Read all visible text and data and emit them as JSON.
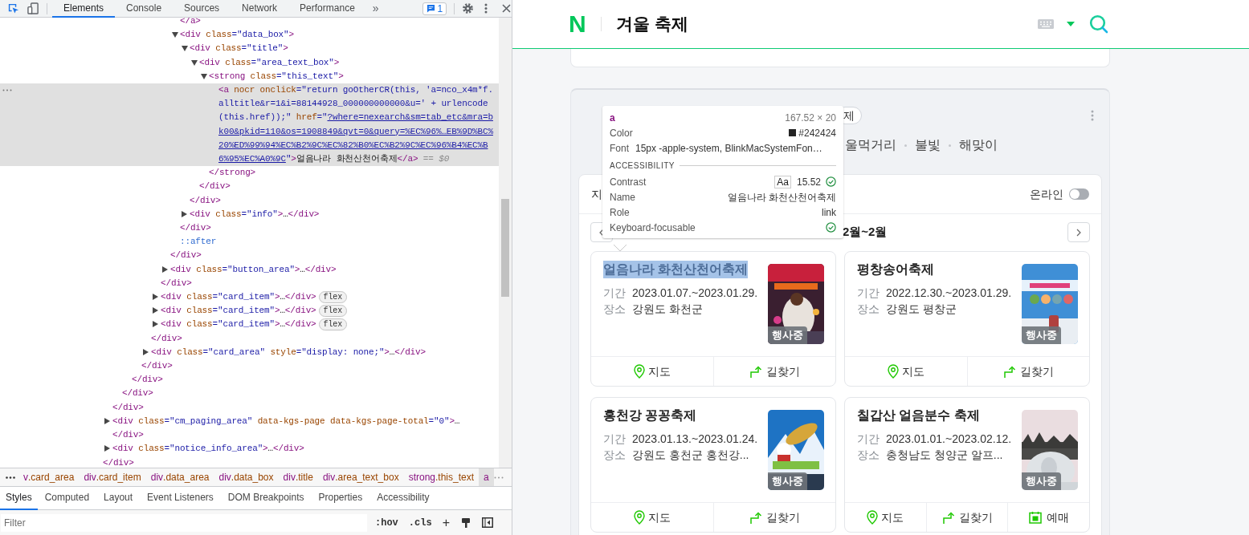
{
  "devtools": {
    "tabs": [
      {
        "label": "Elements",
        "selected": true
      },
      {
        "label": "Console",
        "selected": false
      },
      {
        "label": "Sources",
        "selected": false
      },
      {
        "label": "Network",
        "selected": false
      },
      {
        "label": "Performance",
        "selected": false
      }
    ],
    "more_tabs": "»",
    "issues_count": "1",
    "dom_tree": [
      {
        "children": [
          {
            "children": [
              {
                "children": [
                  {
                    "children": [
                      {
                        "children": [
                          {
                            "children": [
                              {
                                "children": [
                                  {
                                    "children": [
                                      {
                                        "close": [
                                          {
                                            "kind": "tag",
                                            "text": "</a>"
                                          }
                                        ]
                                      },
                                      {
                                        "selected": false,
                                        "expanded": true,
                                        "open": [
                                          {
                                            "kind": "tag",
                                            "text": "<div"
                                          },
                                          {
                                            "kind": "attr",
                                            "text": " class"
                                          },
                                          {
                                            "kind": "eq",
                                            "text": "="
                                          },
                                          {
                                            "kind": "val",
                                            "text": "\"data_box\""
                                          },
                                          {
                                            "kind": "tag",
                                            "text": ">"
                                          }
                                        ],
                                        "children": [
                                          {
                                            "selected": false,
                                            "expanded": true,
                                            "open": [
                                              {
                                                "kind": "tag",
                                                "text": "<div"
                                              },
                                              {
                                                "kind": "attr",
                                                "text": " class"
                                              },
                                              {
                                                "kind": "eq",
                                                "text": "="
                                              },
                                              {
                                                "kind": "val",
                                                "text": "\"title\""
                                              },
                                              {
                                                "kind": "tag",
                                                "text": ">"
                                              }
                                            ],
                                            "children": [
                                              {
                                                "selected": false,
                                                "expanded": true,
                                                "open": [
                                                  {
                                                    "kind": "tag",
                                                    "text": "<div"
                                                  },
                                                  {
                                                    "kind": "attr",
                                                    "text": " class"
                                                  },
                                                  {
                                                    "kind": "eq",
                                                    "text": "="
                                                  },
                                                  {
                                                    "kind": "val",
                                                    "text": "\"area_text_box\""
                                                  },
                                                  {
                                                    "kind": "tag",
                                                    "text": ">"
                                                  }
                                                ],
                                                "children": [
                                                  {
                                                    "selected": false,
                                                    "expanded": true,
                                                    "open": [
                                                      {
                                                        "kind": "tag",
                                                        "text": "<strong"
                                                      },
                                                      {
                                                        "kind": "attr",
                                                        "text": " class"
                                                      },
                                                      {
                                                        "kind": "eq",
                                                        "text": "="
                                                      },
                                                      {
                                                        "kind": "val",
                                                        "text": "\"this_text\""
                                                      },
                                                      {
                                                        "kind": "tag",
                                                        "text": ">"
                                                      }
                                                    ],
                                                    "children": [
                                                      {
                                                        "selected": true,
                                                        "open": [
                                                          {
                                                            "kind": "tag",
                                                            "text": "<a"
                                                          },
                                                          {
                                                            "kind": "attr",
                                                            "text": " nocr"
                                                          },
                                                          {
                                                            "kind": "attr",
                                                            "text": " onclick"
                                                          },
                                                          {
                                                            "kind": "eq",
                                                            "text": "=\""
                                                          },
                                                          {
                                                            "kind": "val",
                                                            "text": "return goOtherCR(this, 'a=nco_x4m*f.alltitle&r=1&i=88144928_000000000000&u=' + urlencode(this.href));"
                                                          },
                                                          {
                                                            "kind": "eq",
                                                            "text": "\""
                                                          },
                                                          {
                                                            "kind": "attr",
                                                            "text": " href"
                                                          },
                                                          {
                                                            "kind": "eq",
                                                            "text": "=\""
                                                          },
                                                          {
                                                            "kind": "link",
                                                            "text": "?where=nexearch&sm=tab_etc&mra=bk00&pkid=110&os=1908849&qvt=0&query=%EC%96%…EB%9D%BC%20%ED%99%94%EC%B2%9C%EC%82%B0%EC%B2%9C%EC%96%B4%EC%B6%95%EC%A0%9C"
                                                          },
                                                          {
                                                            "kind": "eq",
                                                            "text": "\""
                                                          },
                                                          {
                                                            "kind": "tag",
                                                            "text": ">"
                                                          },
                                                          {
                                                            "kind": "text",
                                                            "text": "얼음나라 화천산천어축제"
                                                          },
                                                          {
                                                            "kind": "tag",
                                                            "text": "</a>"
                                                          },
                                                          {
                                                            "kind": "note",
                                                            "text": " == $0"
                                                          }
                                                        ]
                                                      }
                                                    ],
                                                    "close": [
                                                      {
                                                        "kind": "tag",
                                                        "text": "</strong>"
                                                      }
                                                    ]
                                                  }
                                                ],
                                                "close": [
                                                  {
                                                    "kind": "tag",
                                                    "text": "</div>"
                                                  }
                                                ]
                                              }
                                            ],
                                            "close": [
                                              {
                                                "kind": "tag",
                                                "text": "</div>"
                                              }
                                            ]
                                          },
                                          {
                                            "selected": false,
                                            "expanded": false,
                                            "open": [
                                              {
                                                "kind": "tag",
                                                "text": "<div"
                                              },
                                              {
                                                "kind": "attr",
                                                "text": " class"
                                              },
                                              {
                                                "kind": "eq",
                                                "text": "="
                                              },
                                              {
                                                "kind": "val",
                                                "text": "\"info\""
                                              },
                                              {
                                                "kind": "tag",
                                                "text": ">"
                                              },
                                              {
                                                "kind": "text",
                                                "text": "…"
                                              },
                                              {
                                                "kind": "tag",
                                                "text": "</div>"
                                              }
                                            ]
                                          }
                                        ],
                                        "close": [
                                          {
                                            "kind": "tag",
                                            "text": "</div>"
                                          }
                                        ]
                                      },
                                      {
                                        "open": [
                                          {
                                            "kind": "pseudo",
                                            "text": "::after"
                                          }
                                        ]
                                      }
                                    ],
                                    "close": [
                                      {
                                        "kind": "tag",
                                        "text": "</div>"
                                      }
                                    ]
                                  },
                                  {
                                    "selected": false,
                                    "expanded": false,
                                    "open": [
                                      {
                                        "kind": "tag",
                                        "text": "<div"
                                      },
                                      {
                                        "kind": "attr",
                                        "text": " class"
                                      },
                                      {
                                        "kind": "eq",
                                        "text": "="
                                      },
                                      {
                                        "kind": "val",
                                        "text": "\"button_area\""
                                      },
                                      {
                                        "kind": "tag",
                                        "text": ">"
                                      },
                                      {
                                        "kind": "text",
                                        "text": "…"
                                      },
                                      {
                                        "kind": "tag",
                                        "text": "</div>"
                                      }
                                    ]
                                  }
                                ],
                                "close": [
                                  {
                                    "kind": "tag",
                                    "text": "</div>"
                                  }
                                ]
                              },
                              {
                                "selected": false,
                                "expanded": false,
                                "badge": "flex",
                                "open": [
                                  {
                                    "kind": "tag",
                                    "text": "<div"
                                  },
                                  {
                                    "kind": "attr",
                                    "text": " class"
                                  },
                                  {
                                    "kind": "eq",
                                    "text": "="
                                  },
                                  {
                                    "kind": "val",
                                    "text": "\"card_item\""
                                  },
                                  {
                                    "kind": "tag",
                                    "text": ">"
                                  },
                                  {
                                    "kind": "text",
                                    "text": "…"
                                  },
                                  {
                                    "kind": "tag",
                                    "text": "</div>"
                                  }
                                ]
                              },
                              {
                                "selected": false,
                                "expanded": false,
                                "badge": "flex",
                                "open": [
                                  {
                                    "kind": "tag",
                                    "text": "<div"
                                  },
                                  {
                                    "kind": "attr",
                                    "text": " class"
                                  },
                                  {
                                    "kind": "eq",
                                    "text": "="
                                  },
                                  {
                                    "kind": "val",
                                    "text": "\"card_item\""
                                  },
                                  {
                                    "kind": "tag",
                                    "text": ">"
                                  },
                                  {
                                    "kind": "text",
                                    "text": "…"
                                  },
                                  {
                                    "kind": "tag",
                                    "text": "</div>"
                                  }
                                ]
                              },
                              {
                                "selected": false,
                                "expanded": false,
                                "badge": "flex",
                                "open": [
                                  {
                                    "kind": "tag",
                                    "text": "<div"
                                  },
                                  {
                                    "kind": "attr",
                                    "text": " class"
                                  },
                                  {
                                    "kind": "eq",
                                    "text": "="
                                  },
                                  {
                                    "kind": "val",
                                    "text": "\"card_item\""
                                  },
                                  {
                                    "kind": "tag",
                                    "text": ">"
                                  },
                                  {
                                    "kind": "text",
                                    "text": "…"
                                  },
                                  {
                                    "kind": "tag",
                                    "text": "</div>"
                                  }
                                ]
                              }
                            ],
                            "close": [
                              {
                                "kind": "tag",
                                "text": "</div>"
                              }
                            ]
                          },
                          {
                            "selected": false,
                            "expanded": false,
                            "open": [
                              {
                                "kind": "tag",
                                "text": "<div"
                              },
                              {
                                "kind": "attr",
                                "text": " class"
                              },
                              {
                                "kind": "eq",
                                "text": "="
                              },
                              {
                                "kind": "val",
                                "text": "\"card_area\""
                              },
                              {
                                "kind": "attr",
                                "text": " style"
                              },
                              {
                                "kind": "eq",
                                "text": "="
                              },
                              {
                                "kind": "val",
                                "text": "\"display: none;\""
                              },
                              {
                                "kind": "tag",
                                "text": ">"
                              },
                              {
                                "kind": "text",
                                "text": "…"
                              },
                              {
                                "kind": "tag",
                                "text": "</div>"
                              }
                            ]
                          }
                        ],
                        "close": [
                          {
                            "kind": "tag",
                            "text": "</div>"
                          }
                        ]
                      }
                    ],
                    "close": [
                      {
                        "kind": "tag",
                        "text": "</div>"
                      }
                    ]
                  }
                ],
                "close": [
                  {
                    "kind": "tag",
                    "text": "</div>"
                  }
                ]
              }
            ],
            "close": [
              {
                "kind": "tag",
                "text": "</div>"
              }
            ]
          },
          {
            "selected": false,
            "expanded": false,
            "open": [
              {
                "kind": "tag",
                "text": "<div"
              },
              {
                "kind": "attr",
                "text": " class"
              },
              {
                "kind": "eq",
                "text": "="
              },
              {
                "kind": "val",
                "text": "\"cm_paging_area\""
              },
              {
                "kind": "attr",
                "text": " data-kgs-page"
              },
              {
                "kind": "attr",
                "text": " data-kgs-page-total"
              },
              {
                "kind": "eq",
                "text": "="
              },
              {
                "kind": "val",
                "text": "\"0\""
              },
              {
                "kind": "tag",
                "text": ">"
              },
              {
                "kind": "text",
                "text": "…"
              }
            ],
            "close": [
              {
                "kind": "tag",
                "text": "</div>"
              }
            ]
          },
          {
            "selected": false,
            "expanded": false,
            "open": [
              {
                "kind": "tag",
                "text": "<div"
              },
              {
                "kind": "attr",
                "text": " class"
              },
              {
                "kind": "eq",
                "text": "="
              },
              {
                "kind": "val",
                "text": "\"notice_info_area\""
              },
              {
                "kind": "tag",
                "text": ">"
              },
              {
                "kind": "text",
                "text": "…"
              },
              {
                "kind": "tag",
                "text": "</div>"
              }
            ]
          }
        ],
        "close": [
          {
            "kind": "tag",
            "text": "</div>"
          }
        ]
      }
    ],
    "breadcrumbs": [
      {
        "tag": "v",
        "cls": ".card_area",
        "selected": false
      },
      {
        "tag": "div",
        "cls": ".card_item",
        "selected": false
      },
      {
        "tag": "div",
        "cls": ".data_area",
        "selected": false
      },
      {
        "tag": "div",
        "cls": ".data_box",
        "selected": false
      },
      {
        "tag": "div",
        "cls": ".title",
        "selected": false
      },
      {
        "tag": "div",
        "cls": ".area_text_box",
        "selected": false
      },
      {
        "tag": "strong",
        "cls": ".this_text",
        "selected": false
      },
      {
        "tag": "a",
        "selected": true
      }
    ],
    "pane_tabs": [
      {
        "label": "Styles",
        "selected": true
      },
      {
        "label": "Computed",
        "selected": false
      },
      {
        "label": "Layout",
        "selected": false
      },
      {
        "label": "Event Listeners",
        "selected": false
      },
      {
        "label": "DOM Breakpoints",
        "selected": false
      },
      {
        "label": "Properties",
        "selected": false
      },
      {
        "label": "Accessibility",
        "selected": false
      }
    ],
    "filter": {
      "placeholder": "Filter"
    },
    "filter_buttons": [
      ":hov",
      ".cls",
      "+"
    ]
  },
  "tooltip": {
    "tag": "a",
    "size": "167.52 × 20",
    "rows": [
      {
        "label": "Color",
        "color": "#242424",
        "value": "#242424"
      },
      {
        "label": "Font",
        "value": "15px -apple-system, BlinkMacSystemFon…"
      }
    ],
    "section": "ACCESSIBILITY",
    "a11y": [
      {
        "kind": "contrast",
        "label": "Contrast",
        "badge": "Aa",
        "value": "15.52",
        "pass": true
      },
      {
        "kind": "text",
        "label": "Name",
        "value": "얼음나라 화천산천어축제"
      },
      {
        "kind": "text",
        "label": "Role",
        "value": "link"
      },
      {
        "kind": "check",
        "label": "Keyboard-focusable",
        "pass": true
      }
    ]
  },
  "page": {
    "logo": "N",
    "query": "겨울 축제",
    "chip": "제",
    "categories": [
      "울먹거리",
      "불빛",
      "해맞이"
    ],
    "filter_label": "지",
    "toggle": {
      "label": "온라인",
      "on": false
    },
    "period": "2월~2월",
    "cards": [
      {
        "title": "얼음나라 화천산천어축제",
        "highlighted": true,
        "rows": [
          {
            "label": "기간",
            "value": "2023.01.07.~2023.01.29."
          },
          {
            "label": "장소",
            "value": "강원도 화천군"
          }
        ],
        "poster": {
          "kind": "picture"
        },
        "status": "행사중",
        "actions": [
          {
            "kind": "map",
            "label": "지도"
          },
          {
            "kind": "route",
            "label": "길찾기"
          }
        ]
      },
      {
        "title": "평창송어축제",
        "highlighted": false,
        "rows": [
          {
            "label": "기간",
            "value": "2022.12.30.~2023.01.29."
          },
          {
            "label": "장소",
            "value": "강원도 평창군"
          }
        ],
        "poster": {
          "kind": "picture"
        },
        "status": "행사중",
        "actions": [
          {
            "kind": "map",
            "label": "지도"
          },
          {
            "kind": "route",
            "label": "길찾기"
          }
        ]
      },
      {
        "title": "홍천강 꽁꽁축제",
        "highlighted": false,
        "rows": [
          {
            "label": "기간",
            "value": "2023.01.13.~2023.01.24."
          },
          {
            "label": "장소",
            "value": "강원도 홍천군 홍천강..."
          }
        ],
        "poster": {
          "kind": "picture"
        },
        "status": "행사중",
        "actions": [
          {
            "kind": "map",
            "label": "지도"
          },
          {
            "kind": "route",
            "label": "길찾기"
          }
        ]
      },
      {
        "title": "칠갑산 얼음분수 축제",
        "highlighted": false,
        "rows": [
          {
            "label": "기간",
            "value": "2023.01.01.~2023.02.12."
          },
          {
            "label": "장소",
            "value": "충청남도 청양군 알프..."
          }
        ],
        "poster": {
          "kind": "picture"
        },
        "status": "행사중",
        "actions": [
          {
            "kind": "map",
            "label": "지도"
          },
          {
            "kind": "route",
            "label": "길찾기"
          },
          {
            "kind": "booking",
            "label": "예매"
          }
        ]
      }
    ]
  }
}
